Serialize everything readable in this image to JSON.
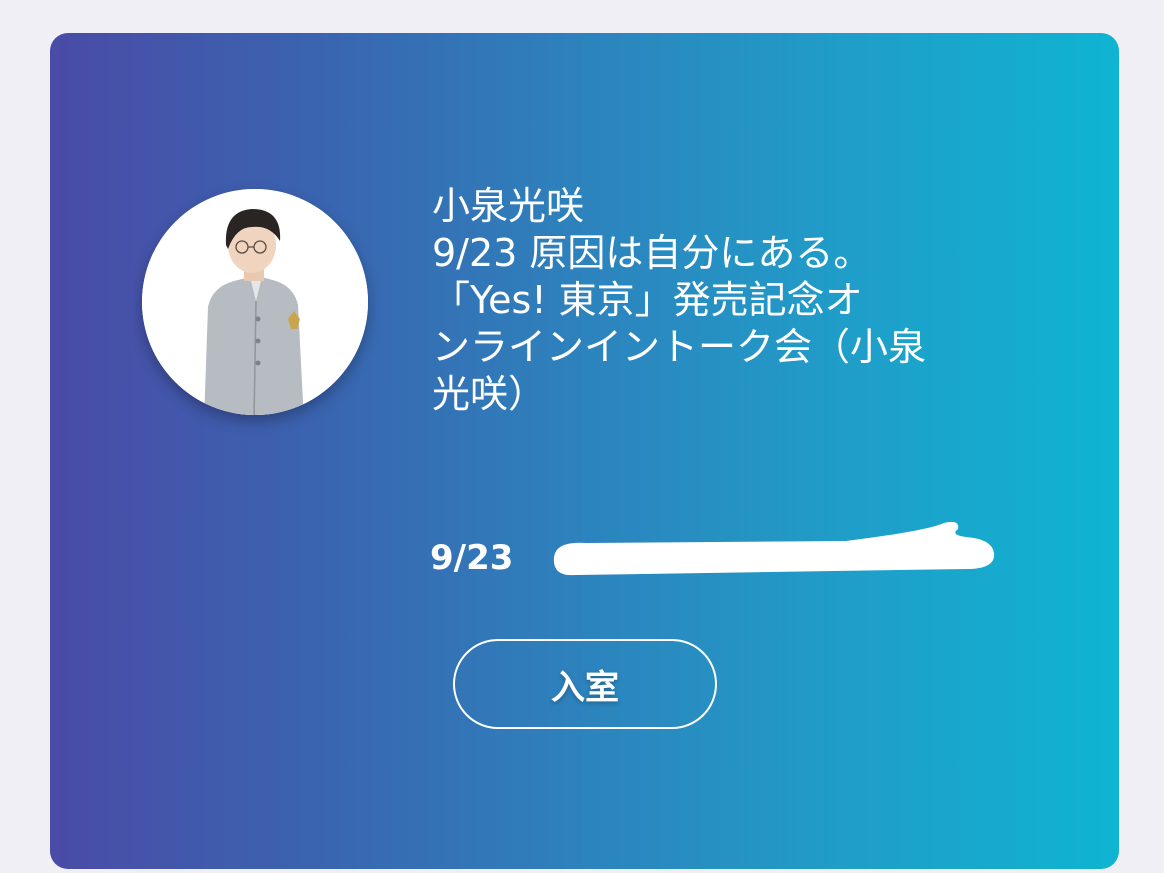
{
  "card": {
    "gradient_start": "#4a4ba6",
    "gradient_end": "#0fb4d2"
  },
  "event": {
    "title_lines": [
      "小泉光咲",
      "9/23 原因は自分にある。",
      "「Yes! 東京」発売記念オ",
      "ンラインイントーク会（小泉",
      "光咲）"
    ],
    "date": "9/23",
    "time_redacted": true
  },
  "avatar": {
    "icon": "profile-photo"
  },
  "actions": {
    "enter_label": "入室"
  }
}
